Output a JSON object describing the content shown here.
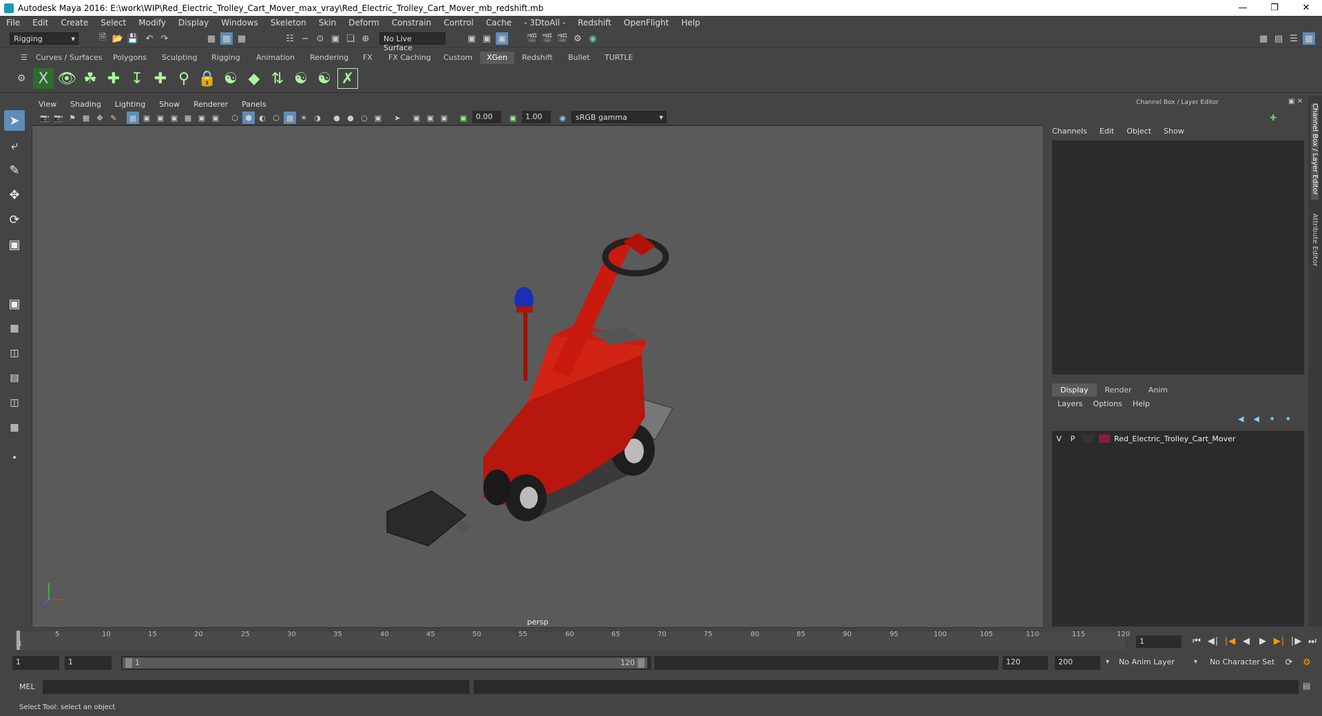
{
  "window": {
    "title": "Autodesk Maya 2016: E:\\work\\WIP\\Red_Electric_Trolley_Cart_Mover_max_vray\\Red_Electric_Trolley_Cart_Mover_mb_redshift.mb"
  },
  "menubar": [
    "File",
    "Edit",
    "Create",
    "Select",
    "Modify",
    "Display",
    "Windows",
    "Skeleton",
    "Skin",
    "Deform",
    "Constrain",
    "Control",
    "Cache",
    "- 3DtoAll -",
    "Redshift",
    "OpenFlight",
    "Help"
  ],
  "statusline": {
    "mode": "Rigging",
    "live_surface": "No Live Surface"
  },
  "shelf_tabs": [
    "Curves / Surfaces",
    "Polygons",
    "Sculpting",
    "Rigging",
    "Animation",
    "Rendering",
    "FX",
    "FX Caching",
    "Custom",
    "XGen",
    "Redshift",
    "Bullet",
    "TURTLE"
  ],
  "shelf_active": "XGen",
  "viewport": {
    "menu": [
      "View",
      "Shading",
      "Lighting",
      "Show",
      "Renderer",
      "Panels"
    ],
    "exposure": "0.00",
    "gamma": "1.00",
    "color_space": "sRGB gamma",
    "camera": "persp"
  },
  "channel_box": {
    "title": "Channel Box / Layer Editor",
    "menu": [
      "Channels",
      "Edit",
      "Object",
      "Show"
    ],
    "layer_tabs": [
      "Display",
      "Render",
      "Anim"
    ],
    "layer_tab_active": "Display",
    "layer_menu": [
      "Layers",
      "Options",
      "Help"
    ],
    "layers": [
      {
        "v": "V",
        "p": "P",
        "name": "Red_Electric_Trolley_Cart_Mover",
        "color": "#8b1c3b"
      }
    ],
    "side_tabs": [
      "Channel Box / Layer Editor",
      "Attribute Editor"
    ]
  },
  "timeline": {
    "ticks": [
      "1",
      "5",
      "10",
      "15",
      "20",
      "25",
      "30",
      "35",
      "40",
      "45",
      "50",
      "55",
      "60",
      "65",
      "70",
      "75",
      "80",
      "85",
      "90",
      "95",
      "100",
      "105",
      "110",
      "115",
      "120"
    ],
    "current_frame": "1"
  },
  "range": {
    "start": "1",
    "playback_start": "1",
    "slider_start": "1",
    "slider_end": "120",
    "playback_end": "120",
    "end": "200",
    "anim_layer": "No Anim Layer",
    "character_set": "No Character Set"
  },
  "command_line": {
    "label": "MEL"
  },
  "help_line": "Select Tool: select an object"
}
